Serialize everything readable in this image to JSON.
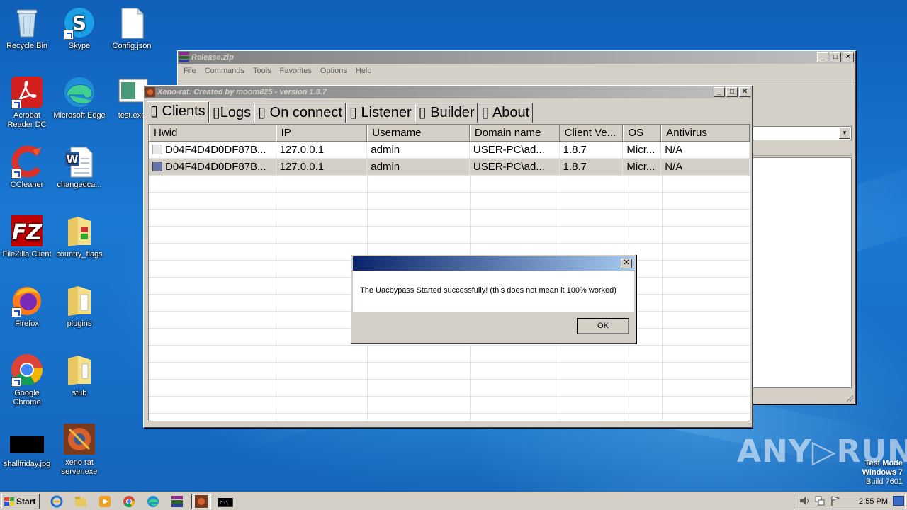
{
  "desktop": {
    "icons": [
      {
        "label": "Recycle Bin"
      },
      {
        "label": "Skype"
      },
      {
        "label": "Config.json"
      },
      {
        "label": "Acrobat Reader DC"
      },
      {
        "label": "Microsoft Edge"
      },
      {
        "label": "test.exe"
      },
      {
        "label": "CCleaner"
      },
      {
        "label": "changedca..."
      },
      {
        "label": "FileZilla Client"
      },
      {
        "label": "country_flags"
      },
      {
        "label": "Firefox"
      },
      {
        "label": "plugins"
      },
      {
        "label": "Google Chrome"
      },
      {
        "label": "stub"
      },
      {
        "label": "shallfriday.jpg"
      },
      {
        "label": "xeno rat server.exe"
      }
    ]
  },
  "winrar": {
    "title": "Release.zip",
    "menu": [
      "File",
      "Commands",
      "Tools",
      "Favorites",
      "Options",
      "Help"
    ]
  },
  "xeno": {
    "title": "Xeno-rat: Created by moom825 - version 1.8.7",
    "tabs": [
      {
        "label": "▯ Clients"
      },
      {
        "label": "▯Logs"
      },
      {
        "label": "▯ On connect"
      },
      {
        "label": "▯ Listener"
      },
      {
        "label": "▯ Builder"
      },
      {
        "label": "▯ About"
      }
    ],
    "columns": [
      "Hwid",
      "IP",
      "Username",
      "Domain name",
      "Client Ve...",
      "OS",
      "Antivirus"
    ],
    "rows": [
      [
        "D04F4D4D0DF87B...",
        "127.0.0.1",
        "admin",
        "USER-PC\\ad...",
        "1.8.7",
        "Micr...",
        "N/A"
      ],
      [
        "D04F4D4D0DF87B...",
        "127.0.0.1",
        "admin",
        "USER-PC\\ad...",
        "1.8.7",
        "Micr...",
        "N/A"
      ]
    ]
  },
  "dialog": {
    "message": "The Uacbypass Started successfully! (this does not mean it 100% worked)",
    "ok_label": "OK",
    "close_label": "✕"
  },
  "taskbar": {
    "start_label": "Start",
    "clock": "2:55 PM"
  },
  "watermark": {
    "text": "ANY▷RUN",
    "mode": "Test Mode",
    "os": "Windows 7",
    "build": "Build 7601"
  },
  "colors": {
    "titlebar_active": "#0a246a",
    "titlebar_gradient_end": "#a6caf0",
    "window_face": "#d4d0c8",
    "desktop_blue": "#1a79d3"
  }
}
